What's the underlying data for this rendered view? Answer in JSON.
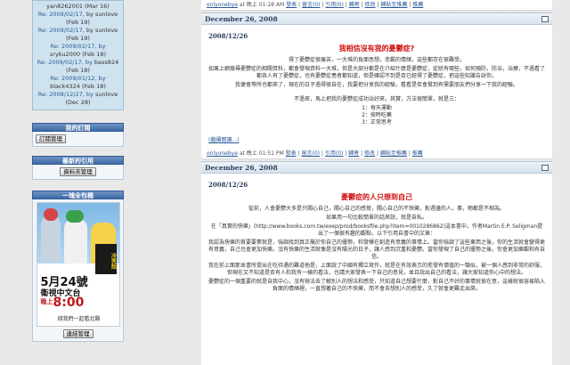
{
  "sidebar": {
    "recent_comments": [
      {
        "text": "yan8262001 (Mar 16)"
      },
      {
        "re": "Re: 2009/02/17,",
        "by": "by sunlove",
        "date": "(Feb 19)"
      },
      {
        "re": "Re: 2009/02/17,",
        "by": "by sunlove",
        "date": "(Feb 19)"
      },
      {
        "re": "Re: 2009/02/17, by",
        "by": "sryku2000",
        "date": "(Feb 18)"
      },
      {
        "re": "Re: 2009/02/17, by",
        "by": "bass824",
        "date": "(Feb 18)"
      },
      {
        "re": "Re: 2009/01/12, by",
        "by": "black4324",
        "date": "(Feb 18)"
      },
      {
        "re": "Re: 2008/12/27, by",
        "by": "sunlove",
        "date": "(Dec 28)"
      }
    ],
    "subscribe_title": "我的訂閱",
    "subscribe_button": "訂閱管理",
    "trackback_title": "最新的引用",
    "trackback_button": "資料夾管理",
    "ad_title": "一塊全包桶",
    "ad_date": "5月24號",
    "ad_channel": "衛視中文台",
    "ad_evening": "晚上",
    "ad_time": "8:00",
    "ad_tagline": "錢我們一起看北縣",
    "ad_seal": "冷笑話",
    "ad_button": "連結管理"
  },
  "main": {
    "top_footer": {
      "author": "onlyonebye",
      "at": "at",
      "time": "晚上 01:28 AM",
      "links": [
        "發表",
        "留言(0)",
        "引用(0)",
        "轉寄",
        "修改",
        "轉貼至推薦",
        "推薦"
      ]
    },
    "post1": {
      "date": "December 26, 2008",
      "subtitle": "2008/12/26",
      "title": "我相信沒有我的憂鬱症?",
      "paras": [
        "得了憂鬱症很痛苦，一大堆的負面思想，悲觀的情緒，這些都存在很難受。",
        "如果上網搜尋憂鬱症的相關資料，都會發現資料一大堆，但是大部分都是在介紹什麼是憂鬱症，症狀有哪些，如何預防，防治，治療，不過看了都各人有了憂鬱症，也有憂鬱症患者都知道，但是確認不到是否已經得了憂鬱症，把這些知識告訴你。",
        "我便會等所也都來了，現在的日子過得很自在，我要把分享我的經驗，看看是否會幫到有需要朋友們分享一下我的經驗。"
      ],
      "intro": "不過來，馬上把我的憂鬱症成功治好來，其實，方法很簡單，就是三：",
      "list": [
        "1：每天運動",
        "2：按時吃藥",
        "3：正常思考"
      ],
      "more": "(繼續閱讀...)"
    },
    "mid_footer": {
      "author": "onlyonebye",
      "at": "at",
      "time": "晚上 01:51 PM",
      "links": [
        "發表",
        "留言(0)",
        "引用(0)",
        "轉寄",
        "修改",
        "轉貼至推薦",
        "推薦"
      ]
    },
    "post2": {
      "date": "December 26, 2008",
      "subtitle": "2008/12/26",
      "title": "憂鬱症的人只想到自己",
      "paras": [
        "從前，人會憂鬱大多是只關心自己，關心自己的感覺，關心自己的不快樂，對週邊的人，事，物都是不相為。",
        "如果用一句比較簡單的話來說，就是自私。",
        "在「真實的快樂」(http://www.books.com.tw/exep/prod/booksfile.php?item=0010286862)這本書中，作者Martin E.P. Seligman提出了一個很有趣的觀點，以下引用自書中的文章：",
        "我認為快樂的首要要素就是，強調找到真正屬於你自己的優勢，和發揮在創造有意義的事情上。當你強調了這些東西之後，你的生活就會變得更有意義，自己也會更加快樂。沒有快樂的生活就像是沒有陽光的日子，讓人感到沉重和憂鬱。當你發現了自己的優勢之後，你會更加樂觀和有自信。",
        "我在前上面那本書所提出在吃待遇的難道他是，上面說了中國有獨立寫作，就是在有效表示的愈發有價值的一類似，被一個人感到非常的舒服，但現在又不知道是否有人和我有一樣的看法，也請大家發表一下自己的意見，並且說出自己的看法，讓大家知道你心中的想法。",
        "憂鬱症的一個重要的就是自我中心，沒有辦法去了解別人的想法和感受，只知道自己想要什麼，對自己不好的事情就很在意，這樣就很容易陷入負面的情緒裡，一直想著自己的不快樂，而不會去想別人的感受，久了就會更難走出來。"
      ]
    }
  }
}
